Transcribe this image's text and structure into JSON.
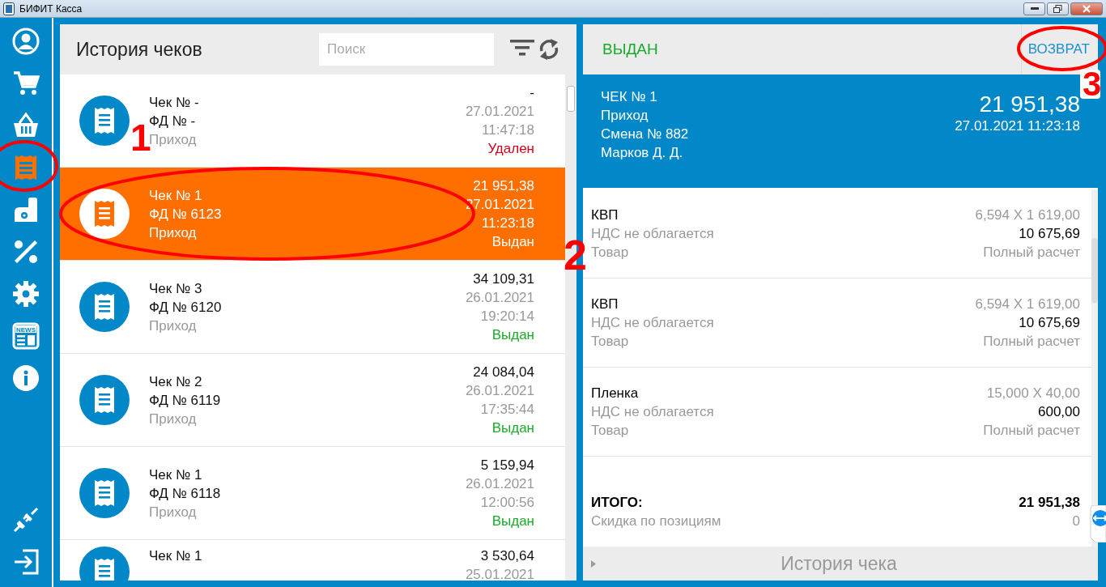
{
  "window": {
    "title": "БИФИТ Касса"
  },
  "sidebar": {
    "items": [
      {
        "kind": "user",
        "selected": false
      },
      {
        "kind": "cart",
        "selected": false
      },
      {
        "kind": "basket",
        "selected": false
      },
      {
        "kind": "receipt",
        "selected": true
      },
      {
        "kind": "register",
        "selected": false
      },
      {
        "kind": "percent",
        "selected": false
      },
      {
        "kind": "settings",
        "selected": false
      },
      {
        "kind": "news",
        "selected": false,
        "label": "NEWS"
      },
      {
        "kind": "info",
        "selected": false
      }
    ],
    "bottom_items": [
      {
        "kind": "plug"
      },
      {
        "kind": "exit"
      }
    ]
  },
  "list_panel": {
    "title": "История чеков",
    "search": {
      "placeholder": "Поиск"
    },
    "receipts": [
      {
        "title": "Чек № -",
        "fd": "ФД № -",
        "type": "Приход",
        "amount": "-",
        "date": "27.01.2021",
        "time": "11:47:18",
        "status": "Удален",
        "color": "#d0021b",
        "selected": false
      },
      {
        "title": "Чек № 1",
        "fd": "ФД № 6123",
        "type": "Приход",
        "amount": "21 951,38",
        "date": "27.01.2021",
        "time": "11:23:18",
        "status": "Выдан",
        "color": "#ffffff",
        "selected": true
      },
      {
        "title": "Чек № 3",
        "fd": "ФД № 6120",
        "type": "Приход",
        "amount": "34 109,31",
        "date": "26.01.2021",
        "time": "19:20:14",
        "status": "Выдан",
        "color": "#1aaa2a",
        "selected": false
      },
      {
        "title": "Чек № 2",
        "fd": "ФД № 6119",
        "type": "Приход",
        "amount": "24 084,04",
        "date": "26.01.2021",
        "time": "17:35:44",
        "status": "Выдан",
        "color": "#1aaa2a",
        "selected": false
      },
      {
        "title": "Чек № 1",
        "fd": "ФД № 6118",
        "type": "Приход",
        "amount": "5 159,94",
        "date": "26.01.2021",
        "time": "12:00:56",
        "status": "Выдан",
        "color": "#1aaa2a",
        "selected": false
      },
      {
        "title": "Чек № 1",
        "amount": "3 530,64",
        "date": "25.01.2021",
        "selected": false
      }
    ]
  },
  "detail_panel": {
    "status": "ВЫДАН",
    "return_button": "ВОЗВРАТ",
    "summary": {
      "title": "ЧЕК № 1",
      "type": "Приход",
      "shift": "Смена № 882",
      "cashier": "Марков Д. Д.",
      "amount": "21 951,38",
      "datetime": "27.01.2021 11:23:18"
    },
    "items": [
      {
        "name": "КВП",
        "tax": "НДС не облагается",
        "kind": "Товар",
        "qty_price": "6,594 X 1 619,00",
        "sum": "10 675,69",
        "payment": "Полный расчет"
      },
      {
        "name": "КВП",
        "tax": "НДС не облагается",
        "kind": "Товар",
        "qty_price": "6,594 X 1 619,00",
        "sum": "10 675,69",
        "payment": "Полный расчет"
      },
      {
        "name": "Пленка",
        "tax": "НДС не облагается",
        "kind": "Товар",
        "qty_price": "15,000 X 40,00",
        "sum": "600,00",
        "payment": "Полный расчет"
      }
    ],
    "total": {
      "label": "ИТОГО:",
      "value": "21 951,38",
      "discount_label": "Скидка по позициям",
      "discount_value": "0"
    },
    "history_bar": "История чека"
  },
  "annotations": [
    {
      "label": "1"
    },
    {
      "label": "2"
    },
    {
      "label": "3"
    }
  ]
}
